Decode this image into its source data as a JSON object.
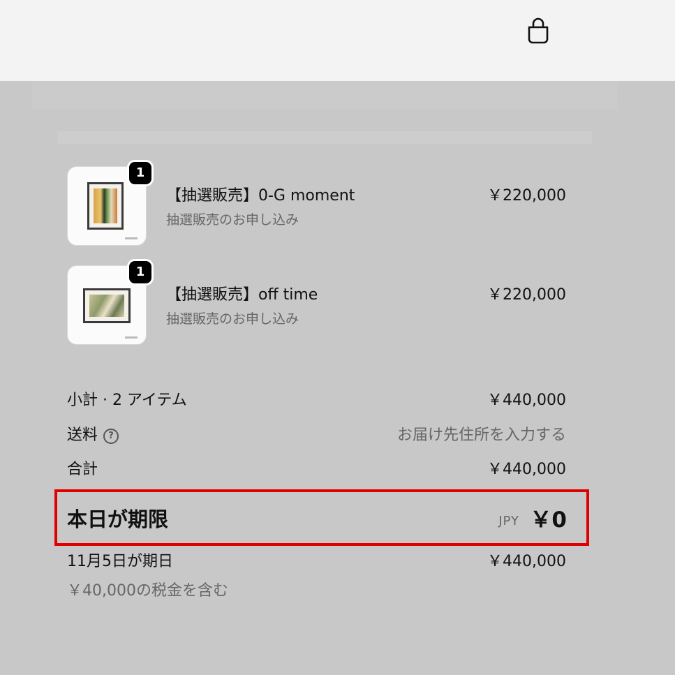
{
  "header": {
    "cart_icon": "shopping-bag-icon"
  },
  "items": [
    {
      "title": "【抽選販売】0-G moment",
      "subtitle": "抽選販売のお申し込み",
      "price": "￥220,000",
      "quantity": "1"
    },
    {
      "title": "【抽選販売】off time",
      "subtitle": "抽選販売のお申し込み",
      "price": "￥220,000",
      "quantity": "1"
    }
  ],
  "summary": {
    "subtotal_label": "小計 · 2 アイテム",
    "subtotal_value": "￥440,000",
    "shipping_label": "送料",
    "shipping_value": "お届け先住所を入力する",
    "total_label": "合計",
    "total_value": "￥440,000"
  },
  "due_today": {
    "label": "本日が期限",
    "currency": "JPY",
    "amount": "￥0"
  },
  "due_later": {
    "label": "11月5日が期日",
    "amount": "￥440,000",
    "tax_note": "￥40,000の税金を含む"
  },
  "colors": {
    "highlight": "#e00000",
    "background": "#c8c8c8",
    "header": "#f3f3f3"
  }
}
